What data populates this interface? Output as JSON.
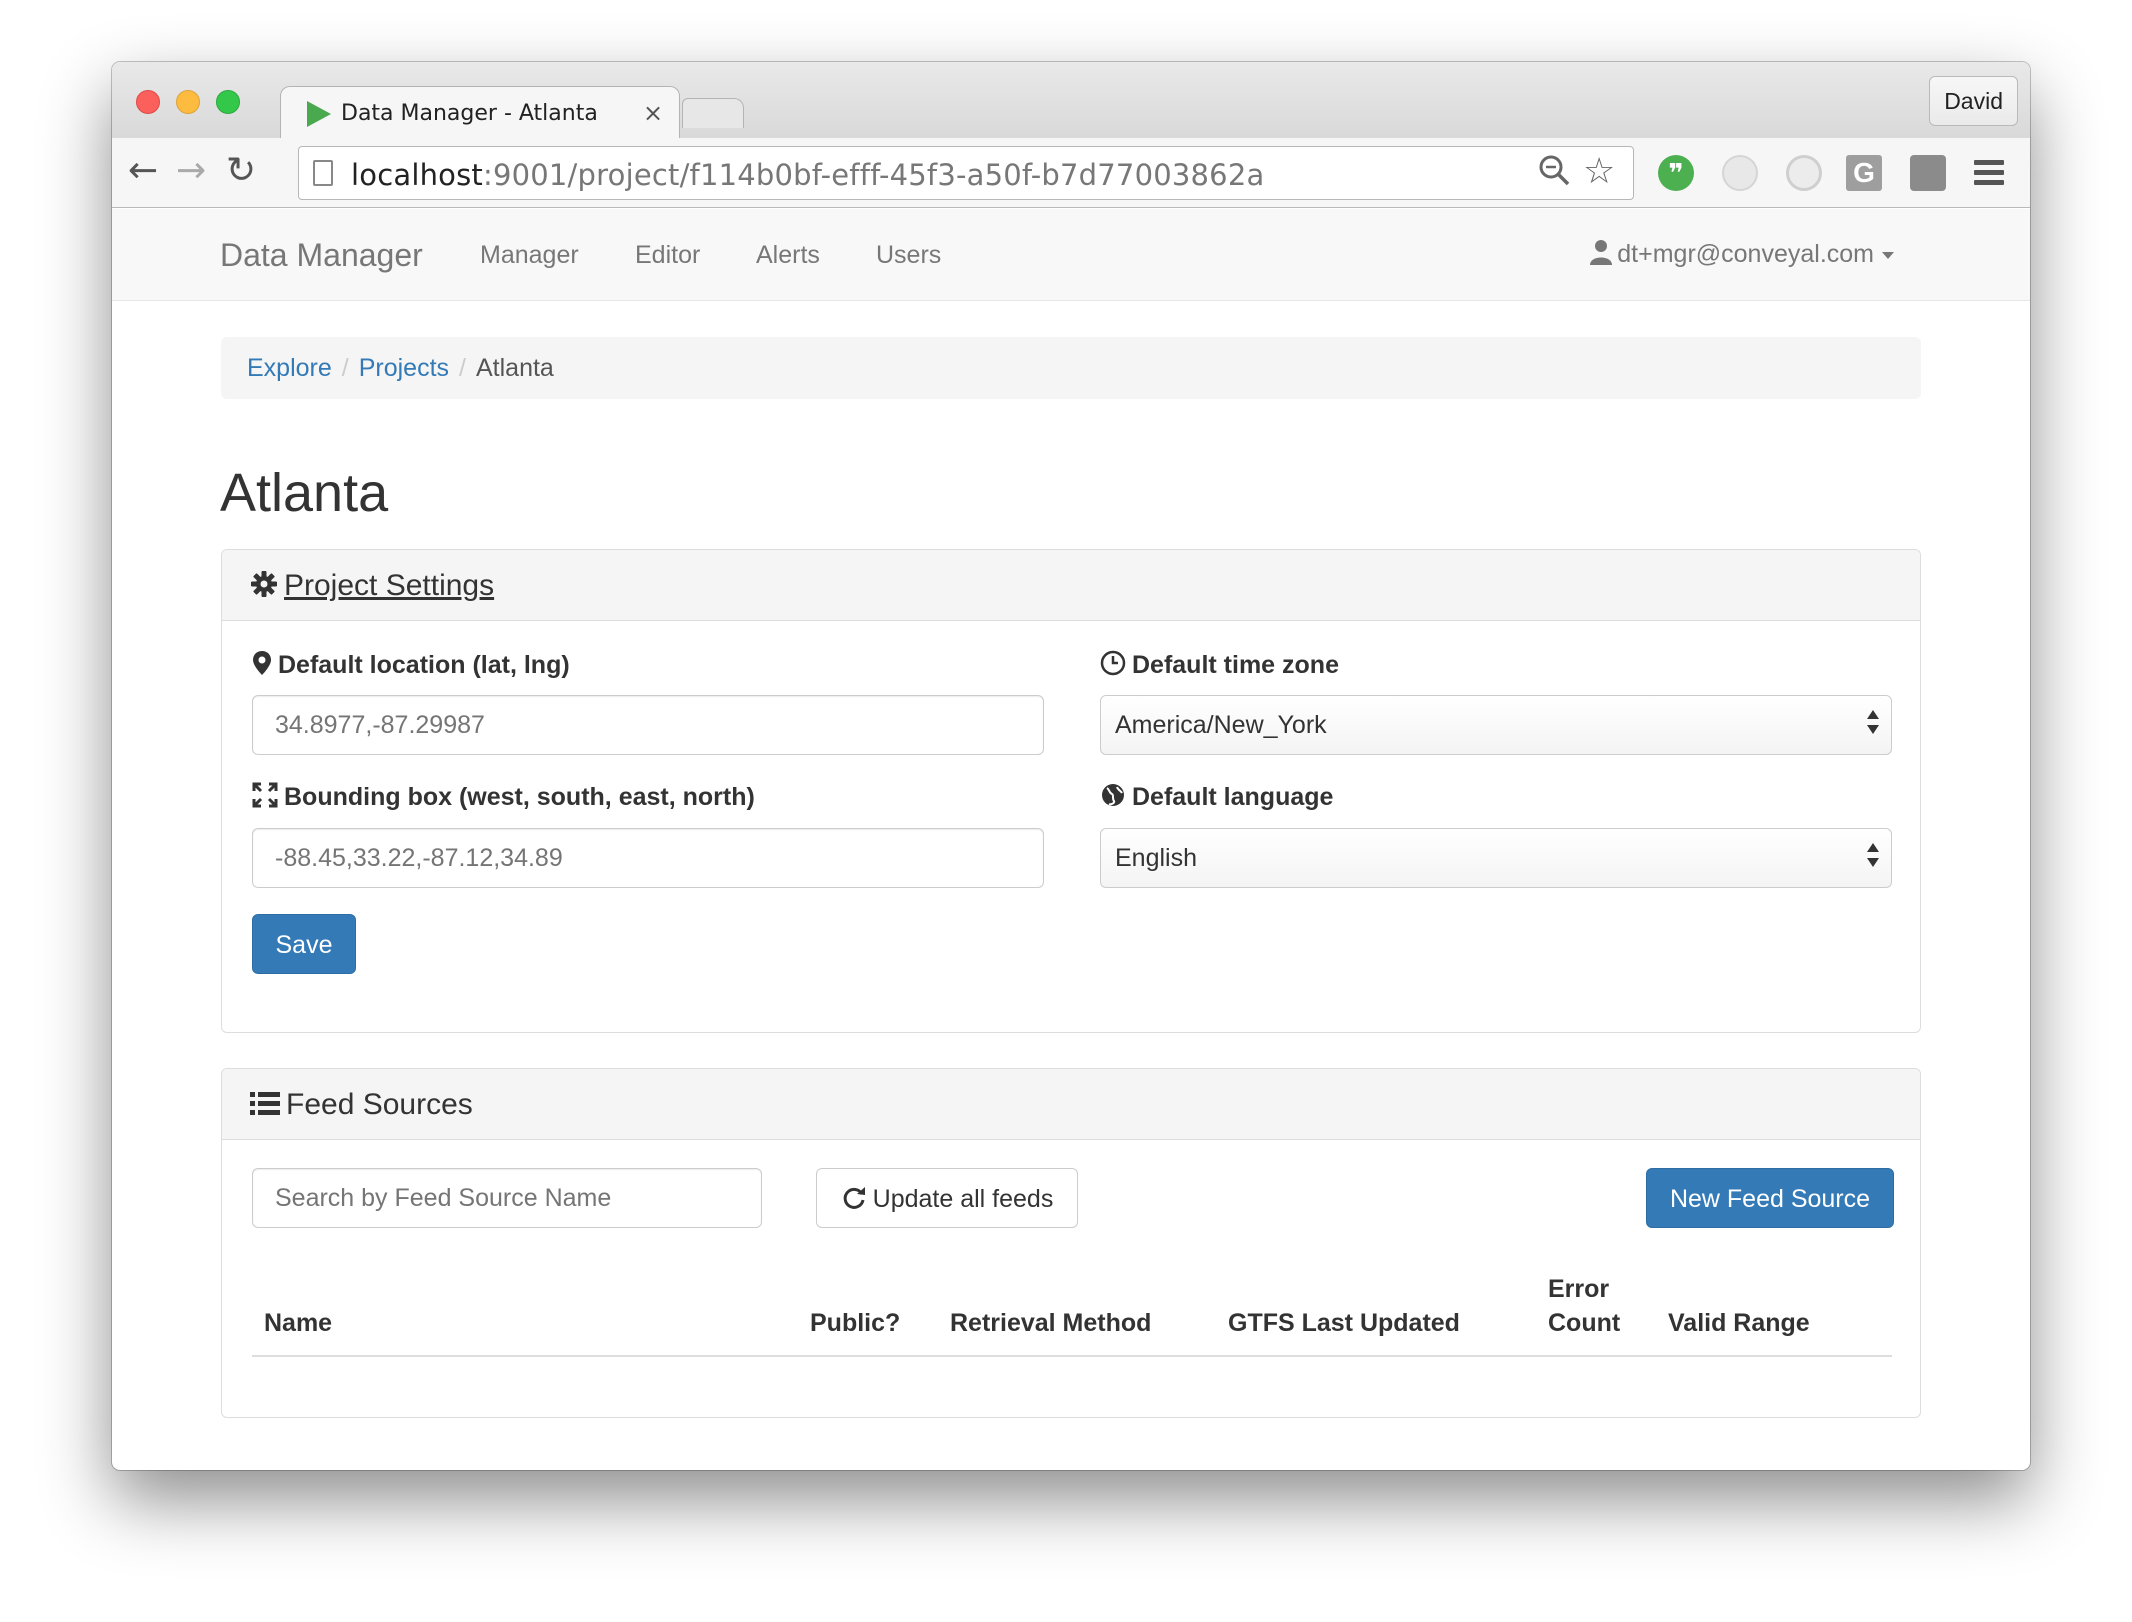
{
  "browser": {
    "tab_title": "Data Manager - Atlanta",
    "tab_close": "×",
    "profile": "David",
    "url_host": "localhost",
    "url_rest": ":9001/project/f114b0bf-efff-45f3-a50f-b7d77003862a",
    "extensions": {
      "hangouts": "❞",
      "grammarly": "G"
    }
  },
  "navbar": {
    "brand": "Data Manager",
    "links": [
      "Manager",
      "Editor",
      "Alerts",
      "Users"
    ],
    "user": "dt+mgr@conveyal.com"
  },
  "breadcrumb": {
    "items": [
      "Explore",
      "Projects"
    ],
    "active": "Atlanta"
  },
  "page": {
    "title": "Atlanta"
  },
  "settings": {
    "heading": "Project Settings",
    "location_label": "Default location (lat, lng)",
    "location_placeholder": "34.8977,-87.29987",
    "timezone_label": "Default time zone",
    "timezone_value": "America/New_York",
    "bbox_label": "Bounding box (west, south, east, north)",
    "bbox_placeholder": "-88.45,33.22,-87.12,34.89",
    "language_label": "Default language",
    "language_value": "English",
    "save_label": "Save"
  },
  "feeds": {
    "heading": "Feed Sources",
    "search_placeholder": "Search by Feed Source Name",
    "update_all_label": "Update all feeds",
    "new_feed_label": "New Feed Source",
    "columns": [
      "Name",
      "Public?",
      "Retrieval Method",
      "GTFS Last Updated",
      "Error",
      "Count",
      "Valid Range"
    ]
  },
  "colors": {
    "primary": "#337ab7",
    "link": "#337ab7",
    "panel_heading": "#f5f5f5"
  }
}
